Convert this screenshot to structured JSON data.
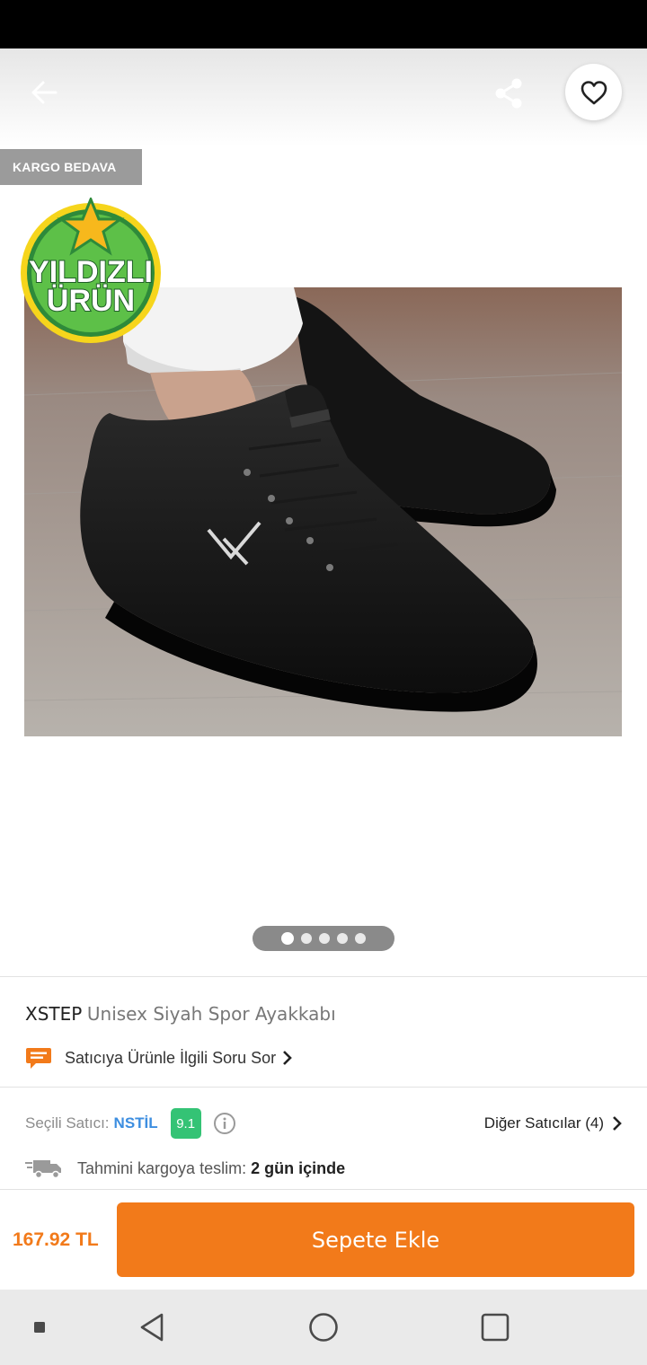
{
  "header": {
    "back_icon": "arrow-left-icon",
    "share_icon": "share-icon",
    "favorite_icon": "heart-outline-icon"
  },
  "gallery": {
    "cargo_badge": "KARGO BEDAVA",
    "star_badge": {
      "line1": "YILDIZLI",
      "line2": "ÜRÜN"
    },
    "image_count": 5,
    "active_index": 0
  },
  "product": {
    "brand": "XSTEP",
    "name": "Unisex Siyah Spor Ayakkabı"
  },
  "ask_seller": {
    "label": "Satıcıya Ürünle İlgili Soru Sor"
  },
  "seller": {
    "prefix": "Seçili Satıcı:",
    "name": "NSTİL",
    "score": "9.1",
    "other_sellers": "Diğer Satıcılar (4)"
  },
  "delivery": {
    "label": "Tahmini kargoya teslim:",
    "value": "2 gün içinde"
  },
  "footer": {
    "price": "167.92 TL",
    "add_to_cart": "Sepete Ekle"
  },
  "colors": {
    "brand_orange": "#f27a1a",
    "seller_blue": "#3d8ee0",
    "score_green": "#34c375"
  }
}
